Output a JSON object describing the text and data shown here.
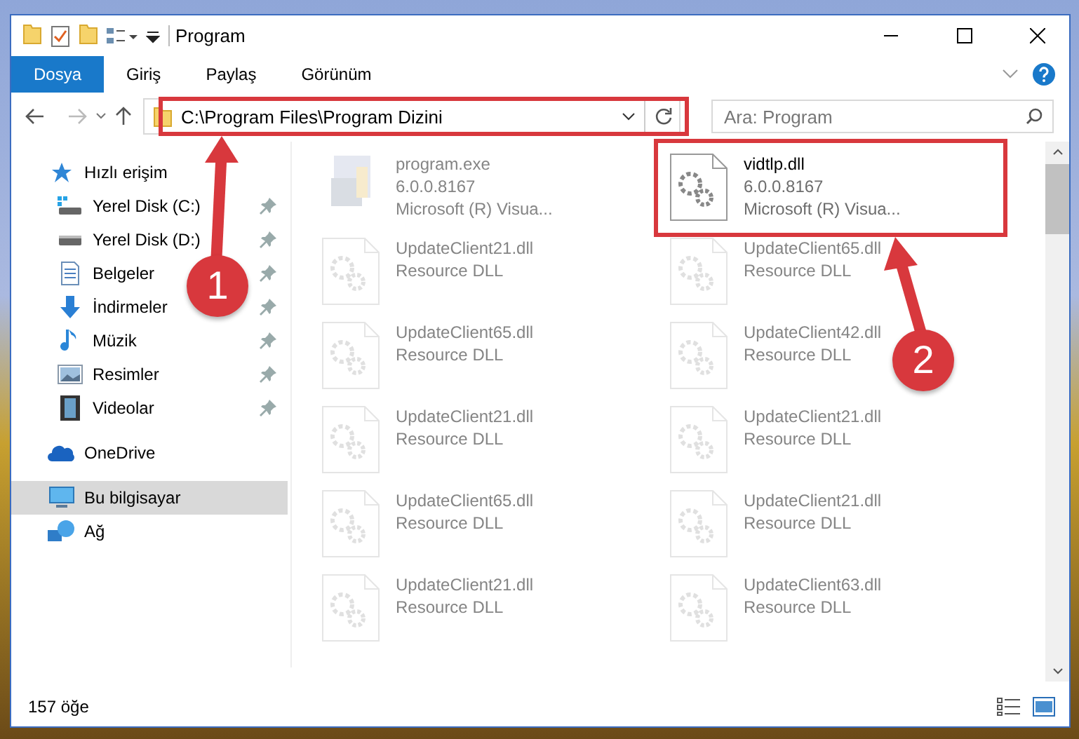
{
  "window": {
    "title": "Program"
  },
  "ribbon_tabs": [
    {
      "label": "Dosya",
      "selected": true
    },
    {
      "label": "Giriş",
      "selected": false
    },
    {
      "label": "Paylaş",
      "selected": false
    },
    {
      "label": "Görünüm",
      "selected": false
    }
  ],
  "address_bar": {
    "path": "C:\\Program Files\\Program Dizini"
  },
  "search": {
    "placeholder": "Ara: Program"
  },
  "sidebar": {
    "items": [
      {
        "label": "Hızlı erişim",
        "kind": "star",
        "selected": false,
        "children": [
          {
            "label": "Yerel Disk (C:)",
            "kind": "drive-c",
            "selected": false,
            "pinned": true
          },
          {
            "label": "Yerel Disk (D:)",
            "kind": "drive",
            "selected": false,
            "pinned": true
          },
          {
            "label": "Belgeler",
            "kind": "document",
            "selected": false,
            "pinned": true
          },
          {
            "label": "İndirmeler",
            "kind": "download",
            "selected": false,
            "pinned": true
          },
          {
            "label": "Müzik",
            "kind": "music",
            "selected": false,
            "pinned": true
          },
          {
            "label": "Resimler",
            "kind": "picture",
            "selected": false,
            "pinned": true
          },
          {
            "label": "Videolar",
            "kind": "video",
            "selected": false,
            "pinned": true
          }
        ]
      },
      {
        "label": "OneDrive",
        "kind": "cloud",
        "selected": false
      },
      {
        "label": "Bu bilgisayar",
        "kind": "computer",
        "selected": true
      },
      {
        "label": "Ağ",
        "kind": "network",
        "selected": false
      }
    ]
  },
  "files": [
    {
      "name": "program.exe",
      "details": [
        "6.0.0.8167",
        "Microsoft (R) Visua..."
      ],
      "kind": "exe",
      "dimmed": true
    },
    {
      "name": "vidtlp.dll",
      "details": [
        "6.0.0.8167",
        "Microsoft (R) Visua..."
      ],
      "kind": "dll",
      "dimmed": false
    },
    {
      "name": "UpdateClient21.dll",
      "details": [
        "Resource DLL"
      ],
      "kind": "dll",
      "dimmed": true
    },
    {
      "name": "UpdateClient65.dll",
      "details": [
        "Resource DLL"
      ],
      "kind": "dll",
      "dimmed": true
    },
    {
      "name": "UpdateClient65.dll",
      "details": [
        "Resource DLL"
      ],
      "kind": "dll",
      "dimmed": true
    },
    {
      "name": "UpdateClient42.dll",
      "details": [
        "Resource DLL"
      ],
      "kind": "dll",
      "dimmed": true
    },
    {
      "name": "UpdateClient21.dll",
      "details": [
        "Resource DLL"
      ],
      "kind": "dll",
      "dimmed": true
    },
    {
      "name": "UpdateClient21.dll",
      "details": [
        "Resource DLL"
      ],
      "kind": "dll",
      "dimmed": true
    },
    {
      "name": "UpdateClient65.dll",
      "details": [
        "Resource DLL"
      ],
      "kind": "dll",
      "dimmed": true
    },
    {
      "name": "UpdateClient21.dll",
      "details": [
        "Resource DLL"
      ],
      "kind": "dll",
      "dimmed": true
    },
    {
      "name": "UpdateClient21.dll",
      "details": [
        "Resource DLL"
      ],
      "kind": "dll",
      "dimmed": true
    },
    {
      "name": "UpdateClient63.dll",
      "details": [
        "Resource DLL"
      ],
      "kind": "dll",
      "dimmed": true
    }
  ],
  "status_bar": {
    "count": "157 öğe"
  },
  "annotations": [
    {
      "number": "1"
    },
    {
      "number": "2"
    }
  ]
}
